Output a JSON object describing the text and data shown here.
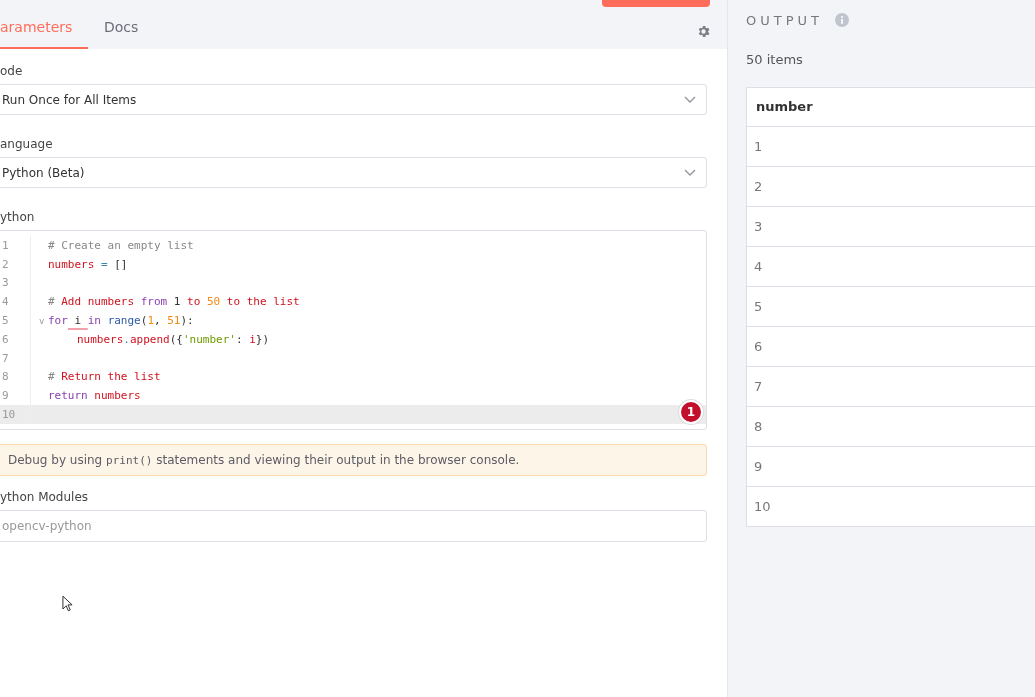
{
  "tabs": [
    {
      "label": "arameters",
      "selected": true
    },
    {
      "label": "Docs",
      "selected": false
    }
  ],
  "fields": [
    {
      "label": "ode",
      "kind": "select",
      "value": "Run Once for All Items"
    },
    {
      "label": "anguage",
      "kind": "select",
      "value": "Python (Beta)"
    }
  ],
  "editor": {
    "label": "ython",
    "badge": "1",
    "lines": [
      {
        "number": "1",
        "active": false,
        "indent": false,
        "tokens": [
          {
            "t": "# Create an empty list",
            "kind": "comment"
          }
        ]
      },
      {
        "number": "2",
        "active": false,
        "indent": false,
        "tokens": [
          {
            "t": "numbers",
            "kind": "var"
          },
          {
            "t": " = ",
            "kind": "op"
          },
          {
            "t": "[]",
            "kind": "plain"
          }
        ]
      },
      {
        "number": "3",
        "active": false
      },
      {
        "number": "4",
        "active": false,
        "indent": false,
        "tokens": [
          {
            "t": "# ",
            "kind": "comment"
          },
          {
            "t": "Add numbers ",
            "kind": "var"
          },
          {
            "t": "from ",
            "kind": "kw"
          },
          {
            "t": "1 ",
            "kind": "plain"
          },
          {
            "t": "to ",
            "kind": "var"
          },
          {
            "t": "50 ",
            "kind": "num"
          },
          {
            "t": "to the list",
            "kind": "var"
          }
        ]
      },
      {
        "number": "5",
        "active": false,
        "indent": false,
        "fold": "v",
        "tokens": [
          {
            "t": "for",
            "kind": "kw"
          },
          {
            "t": " i ",
            "kind": "flagged"
          },
          {
            "t": "in ",
            "kind": "kw"
          },
          {
            "t": "range",
            "kind": "fn"
          },
          {
            "t": "(",
            "kind": "plain"
          },
          {
            "t": "1",
            "kind": "num"
          },
          {
            "t": ", ",
            "kind": "plain"
          },
          {
            "t": "51",
            "kind": "num"
          },
          {
            "t": "):",
            "kind": "plain"
          }
        ]
      },
      {
        "number": "6",
        "active": false,
        "indent": true,
        "tokens": [
          {
            "t": "numbers",
            "kind": "var"
          },
          {
            "t": ".",
            "kind": "op"
          },
          {
            "t": "append",
            "kind": "var"
          },
          {
            "t": "({",
            "kind": "plain"
          },
          {
            "t": "'number'",
            "kind": "str"
          },
          {
            "t": ": ",
            "kind": "plain"
          },
          {
            "t": "i",
            "kind": "var"
          },
          {
            "t": "})",
            "kind": "plain"
          }
        ]
      },
      {
        "number": "7",
        "active": false
      },
      {
        "number": "8",
        "active": false,
        "indent": false,
        "tokens": [
          {
            "t": "# ",
            "kind": "comment"
          },
          {
            "t": "Return the list",
            "kind": "var"
          }
        ]
      },
      {
        "number": "9",
        "active": false,
        "indent": false,
        "tokens": [
          {
            "t": "return ",
            "kind": "kw"
          },
          {
            "t": "numbers",
            "kind": "var"
          }
        ]
      },
      {
        "number": "10",
        "active": true
      }
    ]
  },
  "notice": {
    "before": "Debug by using ",
    "code": "print()",
    "after": " statements and viewing their output in the browser console."
  },
  "modules": {
    "label": "ython Modules",
    "placeholder": "opencv-python"
  },
  "output": {
    "title": "OUTPUT",
    "count": "50 items",
    "column": "number",
    "rows": [
      "1",
      "2",
      "3",
      "4",
      "5",
      "6",
      "7",
      "8",
      "9",
      "10"
    ]
  }
}
